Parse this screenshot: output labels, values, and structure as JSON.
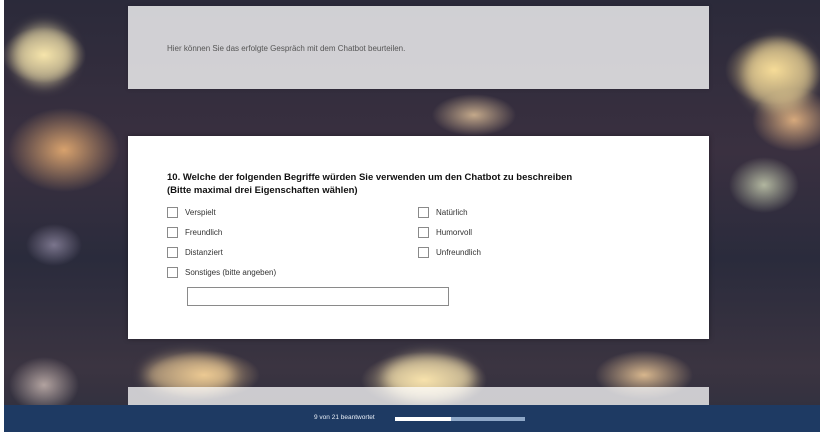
{
  "intro_card": {
    "text": "Hier können Sie das erfolgte Gespräch mit dem Chatbot beurteilen."
  },
  "question": {
    "title_line1": "10. Welche der folgenden Begriffe würden Sie verwenden um den Chatbot zu beschreiben",
    "title_line2": "(Bitte maximal drei Eigenschaften wählen)",
    "options_left": [
      "Verspielt",
      "Freundlich",
      "Distanziert",
      "Sonstiges (bitte angeben)"
    ],
    "options_right": [
      "Natürlich",
      "Humorvoll",
      "Unfreundlich"
    ],
    "other_input_value": ""
  },
  "footer": {
    "progress_text": "9 von 21 beantwortet",
    "progress_fraction": 0.43
  },
  "colors": {
    "footer_bg": "#1e3a63",
    "progress_track": "#8fa8c8",
    "progress_fill": "#ffffff"
  }
}
